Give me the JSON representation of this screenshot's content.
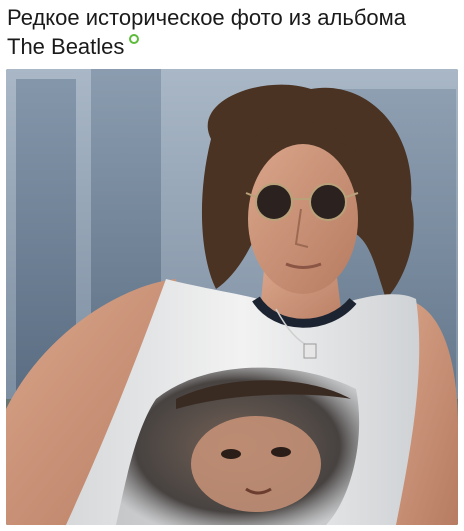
{
  "post": {
    "caption_line1": "Редкое историческое фото из альбома",
    "caption_line2": "The Beatles",
    "online_indicator_color": "#5dbb3a",
    "photo": {
      "subject": "man-with-round-sunglasses-in-sleeveless-shirt",
      "shirt_print": "face-portrait-print"
    }
  }
}
